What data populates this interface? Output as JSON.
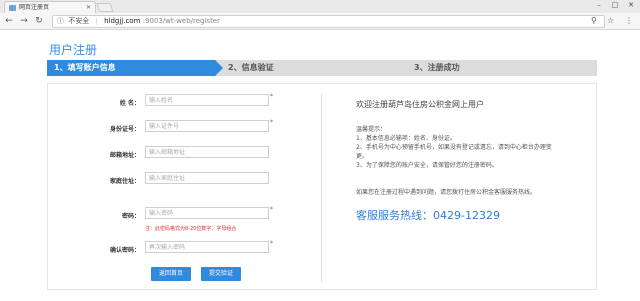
{
  "browser": {
    "tab_title": "网页注册页",
    "security_label": "不安全",
    "url_host": "hldgjj.com",
    "url_path": ":9003/wt-web/register"
  },
  "page": {
    "title": "用户注册",
    "steps": [
      "1、填写账户信息",
      "2、信息验证",
      "3、注册成功"
    ]
  },
  "form": {
    "fields": [
      {
        "label": "姓  名：",
        "placeholder": "输入姓名",
        "required": "*"
      },
      {
        "label": "身份证号：",
        "placeholder": "输入证件号",
        "required": "*"
      },
      {
        "label": "邮箱地址：",
        "placeholder": "输入邮箱地址",
        "required": ""
      },
      {
        "label": "家庭住址：",
        "placeholder": "输入家庭住址",
        "required": ""
      },
      {
        "label": "密码：",
        "placeholder": "输入密码",
        "required": "*"
      },
      {
        "label": "确认密码：",
        "placeholder": "再次输入密码",
        "required": "*"
      }
    ],
    "password_hint": "注：此密码格式为8-20位数字、字母组合",
    "back_button": "返回首页",
    "submit_button": "提交验证"
  },
  "info": {
    "welcome": "欢迎注册葫芦岛住房公积金网上用户",
    "tips": [
      "温馨提示：",
      "1、基本信息必输项：姓名、身份证。",
      "2、手机号为中心预留手机号，如果没有登记或遗忘，请到中心柜台办理变",
      "更。",
      "3、为了保障您的账户安全，请保管好您的注册密码。",
      "如果您在注册过程中遇到问题，请您拨打住房公积金客服服务热线。"
    ],
    "hotline": "客服服务热线：0429-12329"
  },
  "colors": {
    "accent": "#2f8be0",
    "required": "#e03030"
  }
}
